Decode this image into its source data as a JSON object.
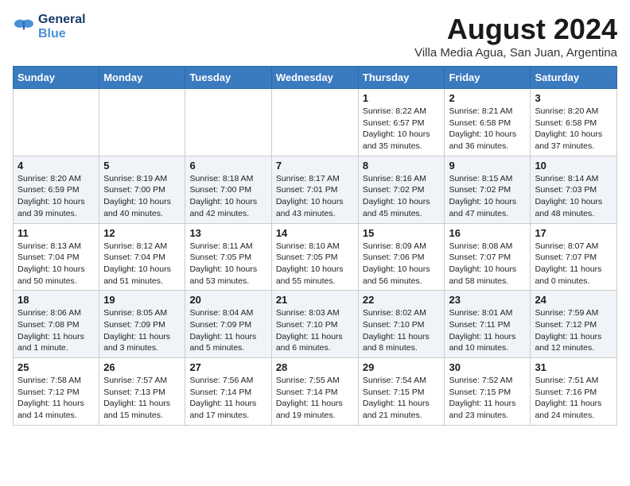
{
  "header": {
    "logo_line1": "General",
    "logo_line2": "Blue",
    "month": "August 2024",
    "location": "Villa Media Agua, San Juan, Argentina"
  },
  "weekdays": [
    "Sunday",
    "Monday",
    "Tuesday",
    "Wednesday",
    "Thursday",
    "Friday",
    "Saturday"
  ],
  "weeks": [
    [
      {
        "day": "",
        "info": ""
      },
      {
        "day": "",
        "info": ""
      },
      {
        "day": "",
        "info": ""
      },
      {
        "day": "",
        "info": ""
      },
      {
        "day": "1",
        "info": "Sunrise: 8:22 AM\nSunset: 6:57 PM\nDaylight: 10 hours\nand 35 minutes."
      },
      {
        "day": "2",
        "info": "Sunrise: 8:21 AM\nSunset: 6:58 PM\nDaylight: 10 hours\nand 36 minutes."
      },
      {
        "day": "3",
        "info": "Sunrise: 8:20 AM\nSunset: 6:58 PM\nDaylight: 10 hours\nand 37 minutes."
      }
    ],
    [
      {
        "day": "4",
        "info": "Sunrise: 8:20 AM\nSunset: 6:59 PM\nDaylight: 10 hours\nand 39 minutes."
      },
      {
        "day": "5",
        "info": "Sunrise: 8:19 AM\nSunset: 7:00 PM\nDaylight: 10 hours\nand 40 minutes."
      },
      {
        "day": "6",
        "info": "Sunrise: 8:18 AM\nSunset: 7:00 PM\nDaylight: 10 hours\nand 42 minutes."
      },
      {
        "day": "7",
        "info": "Sunrise: 8:17 AM\nSunset: 7:01 PM\nDaylight: 10 hours\nand 43 minutes."
      },
      {
        "day": "8",
        "info": "Sunrise: 8:16 AM\nSunset: 7:02 PM\nDaylight: 10 hours\nand 45 minutes."
      },
      {
        "day": "9",
        "info": "Sunrise: 8:15 AM\nSunset: 7:02 PM\nDaylight: 10 hours\nand 47 minutes."
      },
      {
        "day": "10",
        "info": "Sunrise: 8:14 AM\nSunset: 7:03 PM\nDaylight: 10 hours\nand 48 minutes."
      }
    ],
    [
      {
        "day": "11",
        "info": "Sunrise: 8:13 AM\nSunset: 7:04 PM\nDaylight: 10 hours\nand 50 minutes."
      },
      {
        "day": "12",
        "info": "Sunrise: 8:12 AM\nSunset: 7:04 PM\nDaylight: 10 hours\nand 51 minutes."
      },
      {
        "day": "13",
        "info": "Sunrise: 8:11 AM\nSunset: 7:05 PM\nDaylight: 10 hours\nand 53 minutes."
      },
      {
        "day": "14",
        "info": "Sunrise: 8:10 AM\nSunset: 7:05 PM\nDaylight: 10 hours\nand 55 minutes."
      },
      {
        "day": "15",
        "info": "Sunrise: 8:09 AM\nSunset: 7:06 PM\nDaylight: 10 hours\nand 56 minutes."
      },
      {
        "day": "16",
        "info": "Sunrise: 8:08 AM\nSunset: 7:07 PM\nDaylight: 10 hours\nand 58 minutes."
      },
      {
        "day": "17",
        "info": "Sunrise: 8:07 AM\nSunset: 7:07 PM\nDaylight: 11 hours\nand 0 minutes."
      }
    ],
    [
      {
        "day": "18",
        "info": "Sunrise: 8:06 AM\nSunset: 7:08 PM\nDaylight: 11 hours\nand 1 minute."
      },
      {
        "day": "19",
        "info": "Sunrise: 8:05 AM\nSunset: 7:09 PM\nDaylight: 11 hours\nand 3 minutes."
      },
      {
        "day": "20",
        "info": "Sunrise: 8:04 AM\nSunset: 7:09 PM\nDaylight: 11 hours\nand 5 minutes."
      },
      {
        "day": "21",
        "info": "Sunrise: 8:03 AM\nSunset: 7:10 PM\nDaylight: 11 hours\nand 6 minutes."
      },
      {
        "day": "22",
        "info": "Sunrise: 8:02 AM\nSunset: 7:10 PM\nDaylight: 11 hours\nand 8 minutes."
      },
      {
        "day": "23",
        "info": "Sunrise: 8:01 AM\nSunset: 7:11 PM\nDaylight: 11 hours\nand 10 minutes."
      },
      {
        "day": "24",
        "info": "Sunrise: 7:59 AM\nSunset: 7:12 PM\nDaylight: 11 hours\nand 12 minutes."
      }
    ],
    [
      {
        "day": "25",
        "info": "Sunrise: 7:58 AM\nSunset: 7:12 PM\nDaylight: 11 hours\nand 14 minutes."
      },
      {
        "day": "26",
        "info": "Sunrise: 7:57 AM\nSunset: 7:13 PM\nDaylight: 11 hours\nand 15 minutes."
      },
      {
        "day": "27",
        "info": "Sunrise: 7:56 AM\nSunset: 7:14 PM\nDaylight: 11 hours\nand 17 minutes."
      },
      {
        "day": "28",
        "info": "Sunrise: 7:55 AM\nSunset: 7:14 PM\nDaylight: 11 hours\nand 19 minutes."
      },
      {
        "day": "29",
        "info": "Sunrise: 7:54 AM\nSunset: 7:15 PM\nDaylight: 11 hours\nand 21 minutes."
      },
      {
        "day": "30",
        "info": "Sunrise: 7:52 AM\nSunset: 7:15 PM\nDaylight: 11 hours\nand 23 minutes."
      },
      {
        "day": "31",
        "info": "Sunrise: 7:51 AM\nSunset: 7:16 PM\nDaylight: 11 hours\nand 24 minutes."
      }
    ]
  ]
}
